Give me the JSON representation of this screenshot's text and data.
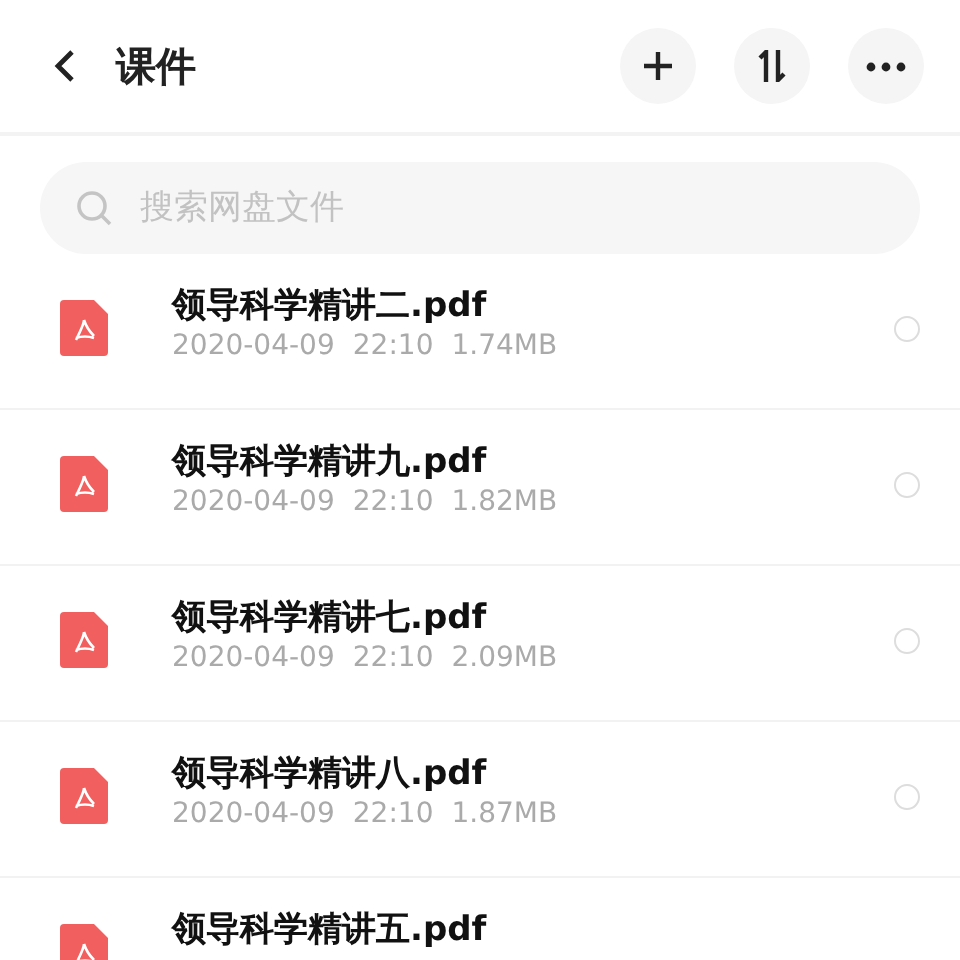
{
  "header": {
    "title": "课件"
  },
  "search": {
    "placeholder": "搜索网盘文件"
  },
  "files": [
    {
      "name": "领导科学精讲二.pdf",
      "date": "2020-04-09",
      "time": "22:10",
      "size": "1.74MB",
      "selected": false
    },
    {
      "name": "领导科学精讲九.pdf",
      "date": "2020-04-09",
      "time": "22:10",
      "size": "1.82MB",
      "selected": false
    },
    {
      "name": "领导科学精讲七.pdf",
      "date": "2020-04-09",
      "time": "22:10",
      "size": "2.09MB",
      "selected": false
    },
    {
      "name": "领导科学精讲八.pdf",
      "date": "2020-04-09",
      "time": "22:10",
      "size": "1.87MB",
      "selected": false
    },
    {
      "name": "领导科学精讲五.pdf"
    }
  ]
}
